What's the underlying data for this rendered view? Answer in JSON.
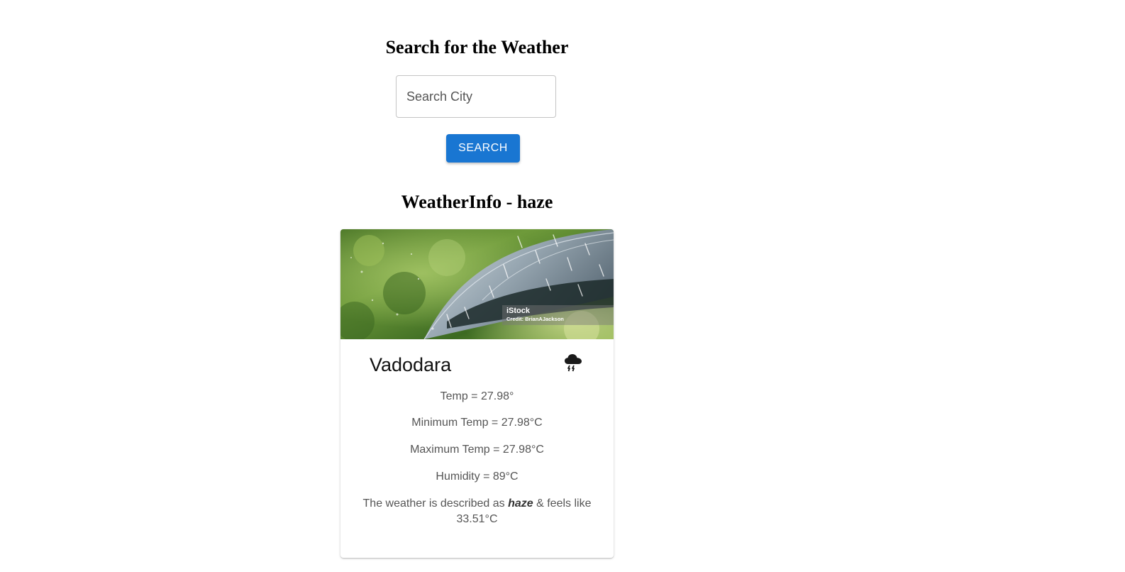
{
  "search": {
    "heading": "Search for the Weather",
    "placeholder": "Search City",
    "value": "",
    "button_label": "SEARCH",
    "button_color": "#1976d2"
  },
  "weather_info": {
    "heading": "WeatherInfo - haze",
    "image": {
      "watermark_brand": "iStock",
      "watermark_credit": "Credit: BrianAJackson"
    },
    "city": "Vadodara",
    "icon": "thunderstorm-cloud-icon",
    "temp": "Temp = 27.98°",
    "min_temp": "Minimum Temp = 27.98°C",
    "max_temp": "Maximum Temp = 27.98°C",
    "humidity": "Humidity = 89°C",
    "description_prefix": "The weather is described as ",
    "description_word": "haze",
    "description_suffix": " & feels like 33.51°C"
  }
}
